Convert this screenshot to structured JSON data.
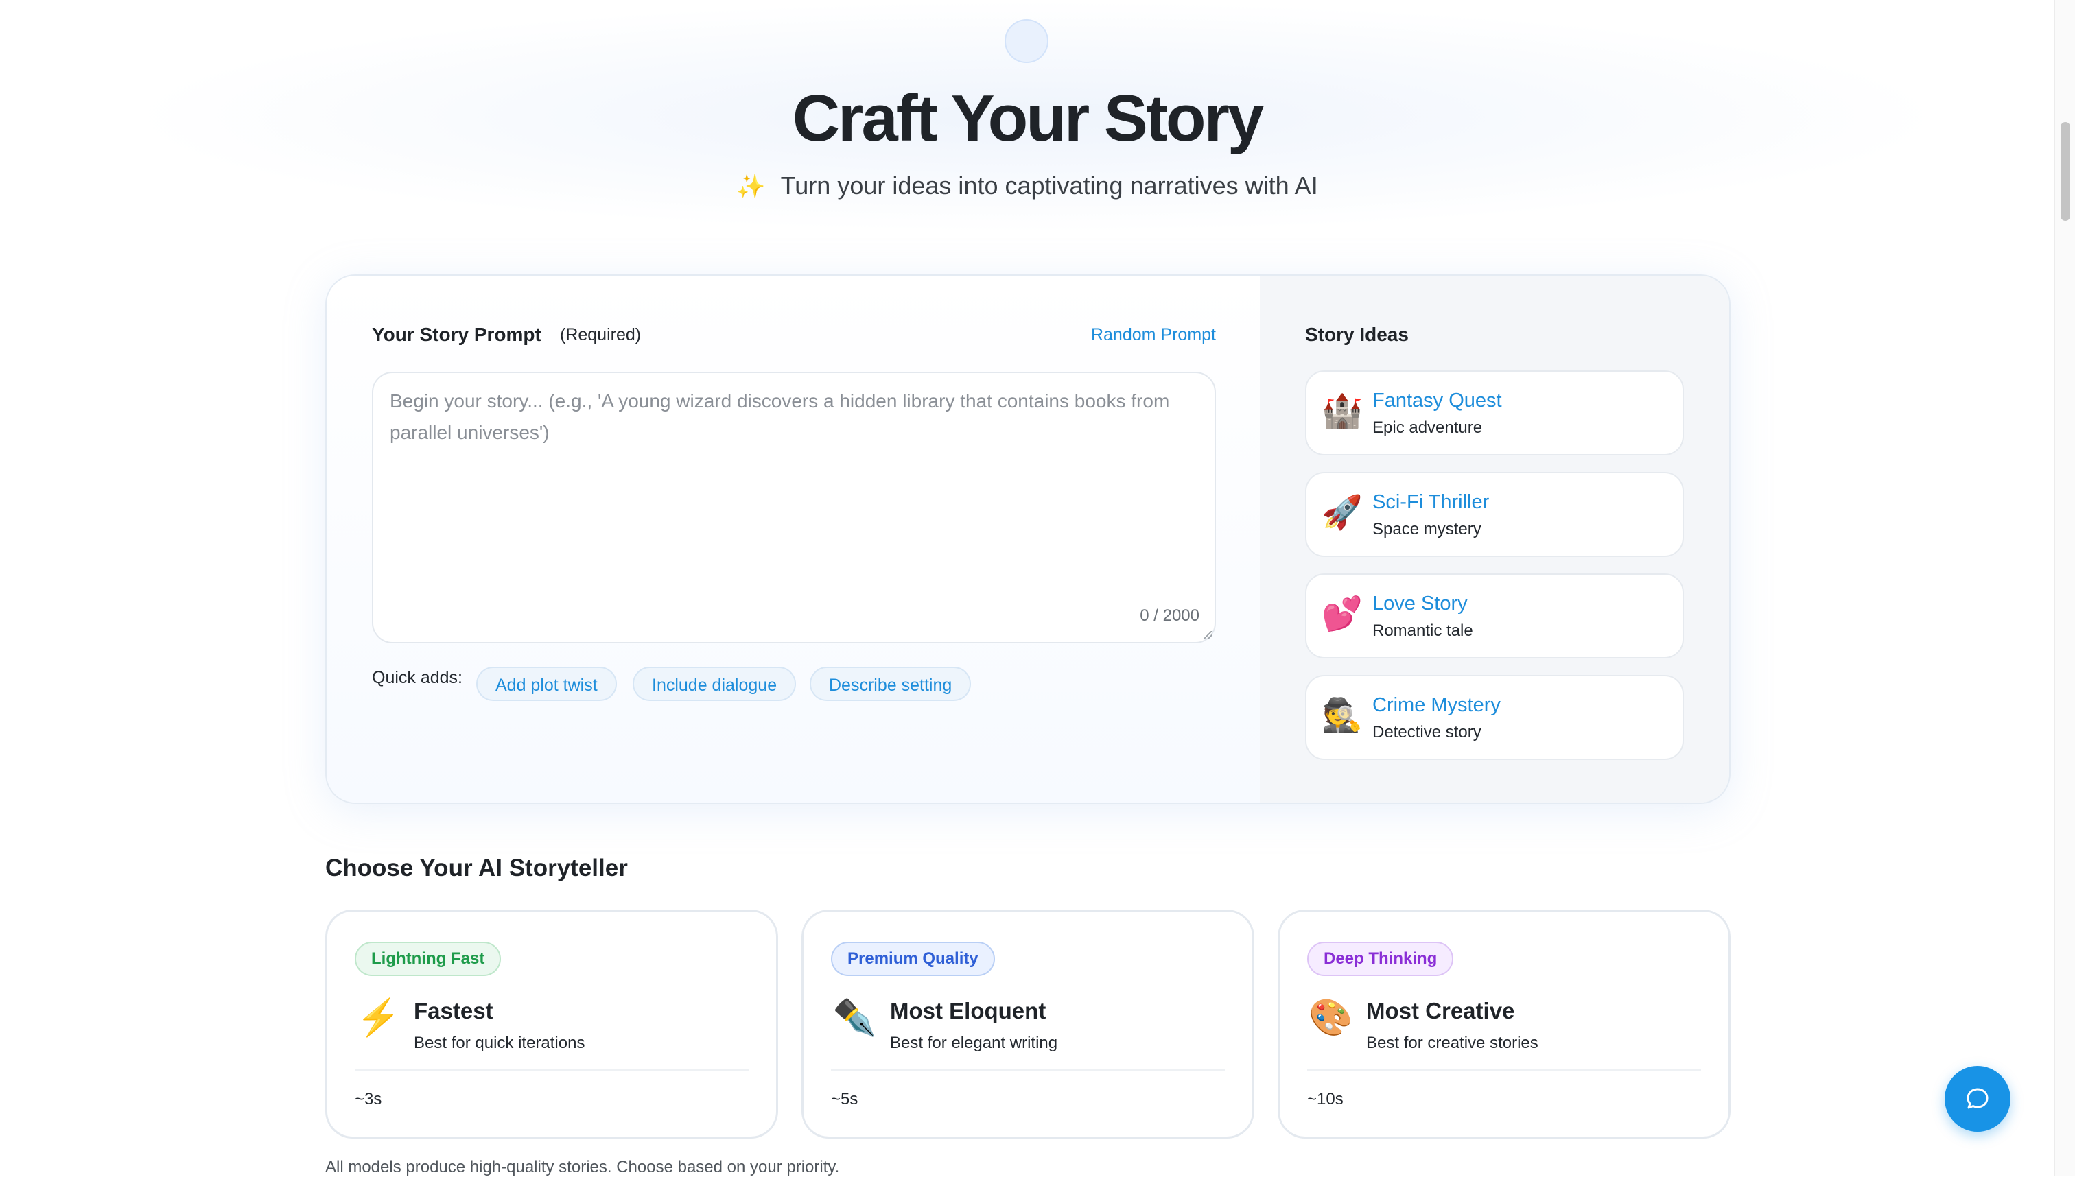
{
  "hero": {
    "title": "Craft Your Story",
    "subtitle_icon": "✨",
    "subtitle": "Turn your ideas into captivating narratives with AI"
  },
  "prompt": {
    "label": "Your Story Prompt",
    "required_label": "(Required)",
    "random_link": "Random Prompt",
    "placeholder": "Begin your story... (e.g., 'A young wizard discovers a hidden library that contains books from parallel universes')",
    "value": "",
    "char_count": "0 / 2000",
    "quick_adds_label": "Quick adds:",
    "quick_adds": [
      "Add plot twist",
      "Include dialogue",
      "Describe setting"
    ]
  },
  "ideas": {
    "title": "Story Ideas",
    "items": [
      {
        "icon": "🏰",
        "icon_name": "castle-icon",
        "title": "Fantasy Quest",
        "subtitle": "Epic adventure"
      },
      {
        "icon": "🚀",
        "icon_name": "rocket-icon",
        "title": "Sci-Fi Thriller",
        "subtitle": "Space mystery"
      },
      {
        "icon": "💕",
        "icon_name": "hearts-icon",
        "title": "Love Story",
        "subtitle": "Romantic tale"
      },
      {
        "icon": "🕵️",
        "icon_name": "detective-icon",
        "title": "Crime Mystery",
        "subtitle": "Detective story"
      }
    ]
  },
  "models": {
    "section_title": "Choose Your AI Storyteller",
    "cards": [
      {
        "badge": "Lightning Fast",
        "badge_color": "#1e9b4a",
        "icon": "⚡",
        "icon_name": "lightning-icon",
        "name": "Fastest",
        "description": "Best for quick iterations",
        "time": "~3s"
      },
      {
        "badge": "Premium Quality",
        "badge_color": "#2f5fd6",
        "icon": "✒️",
        "icon_name": "pen-nib-icon",
        "name": "Most Eloquent",
        "description": "Best for elegant writing",
        "time": "~5s"
      },
      {
        "badge": "Deep Thinking",
        "badge_color": "#8a2fd6",
        "icon": "🎨",
        "icon_name": "palette-icon",
        "name": "Most Creative",
        "description": "Best for creative stories",
        "time": "~10s"
      }
    ],
    "footnote": "All models produce high-quality stories. Choose based on your priority."
  },
  "colors": {
    "accent": "#1d8ddb",
    "fab": "#1893e6"
  }
}
